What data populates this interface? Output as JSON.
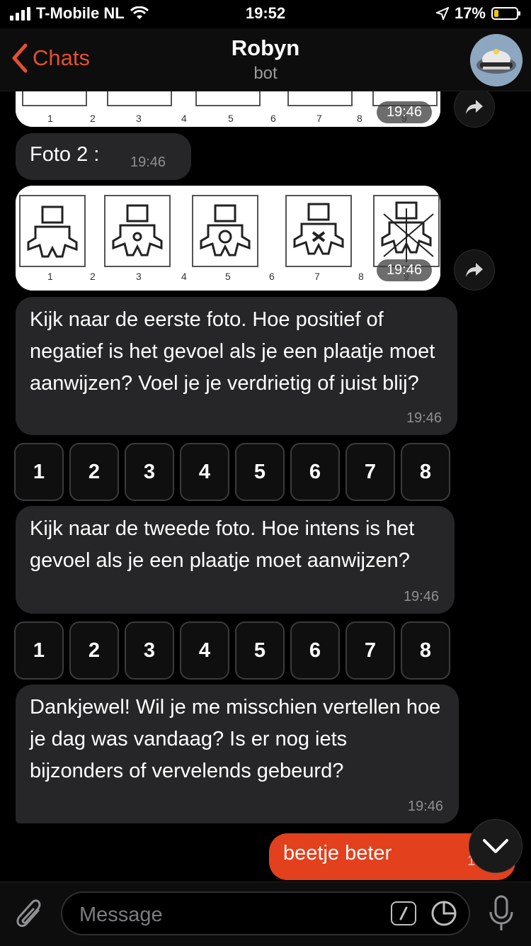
{
  "status": {
    "carrier": "T-Mobile NL",
    "time": "19:52",
    "battery": "17%"
  },
  "header": {
    "back_label": "Chats",
    "title": "Robyn",
    "subtitle": "bot"
  },
  "messages": {
    "top_image_time": "19:46",
    "top_image_numbers": [
      "1",
      "2",
      "3",
      "4",
      "5",
      "6",
      "7",
      "8",
      "9"
    ],
    "photo2_label": "Foto 2 :",
    "photo2_time": "19:46",
    "image2_time": "19:46",
    "image2_numbers": [
      "1",
      "2",
      "3",
      "4",
      "5",
      "6",
      "7",
      "8",
      "9"
    ],
    "q1_text": "Kijk naar de eerste foto. Hoe positief of negatief is het gevoel als je een plaatje moet aanwijzen? Voel je je verdrietig of juist blij?",
    "q1_time": "19:46",
    "q2_text": "Kijk naar de tweede foto. Hoe intens is het gevoel als je een plaatje moet aanwijzen?",
    "q2_time": "19:46",
    "thanks_text": "Dankjewel! Wil je me misschien vertellen hoe je dag was vandaag? Is er nog iets bijzonders of vervelends gebeurd?",
    "thanks_time": "19:46",
    "out_text": "beetje beter",
    "out_time": "19:46"
  },
  "keyboard1": [
    "1",
    "2",
    "3",
    "4",
    "5",
    "6",
    "7",
    "8"
  ],
  "keyboard2": [
    "1",
    "2",
    "3",
    "4",
    "5",
    "6",
    "7",
    "8"
  ],
  "input": {
    "placeholder": "Message"
  },
  "colors": {
    "accent": "#e2502f",
    "outgoing": "#e3401d",
    "incoming": "#262628",
    "background": "#000000"
  }
}
